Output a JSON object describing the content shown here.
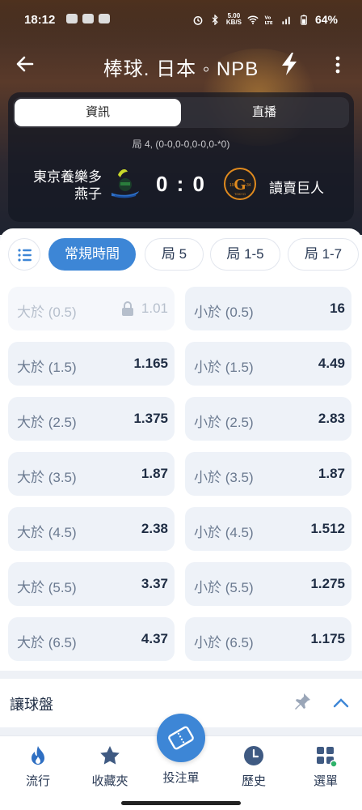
{
  "status": {
    "time": "18:12",
    "speed_top": "5.00",
    "speed_unit": "KB/S",
    "battery": "64%"
  },
  "topbar": {
    "title": "棒球. 日本 ◦ NPB"
  },
  "match": {
    "tabs": [
      {
        "label": "資訊",
        "active": true
      },
      {
        "label": "直播",
        "active": false
      }
    ],
    "inning_info": "局 4, (0-0,0-0,0-0,0-*0)",
    "home_team": "東京養樂多燕子",
    "score": "0 : 0",
    "away_team": "讀賣巨人",
    "away_logo_text": "G",
    "away_logo_years_left": "19",
    "away_logo_years_right": "34",
    "away_logo_city": "TOKYO"
  },
  "filters": [
    {
      "label": "常規時間",
      "active": true
    },
    {
      "label": "局 5",
      "active": false
    },
    {
      "label": "局 1-5",
      "active": false
    },
    {
      "label": "局 1-7",
      "active": false
    }
  ],
  "odds": [
    {
      "over_label": "大於 (0.5)",
      "over_value": "1.01",
      "over_locked": true,
      "under_label": "小於 (0.5)",
      "under_value": "16"
    },
    {
      "over_label": "大於 (1.5)",
      "over_value": "1.165",
      "over_locked": false,
      "under_label": "小於 (1.5)",
      "under_value": "4.49"
    },
    {
      "over_label": "大於 (2.5)",
      "over_value": "1.375",
      "over_locked": false,
      "under_label": "小於 (2.5)",
      "under_value": "2.83"
    },
    {
      "over_label": "大於 (3.5)",
      "over_value": "1.87",
      "over_locked": false,
      "under_label": "小於 (3.5)",
      "under_value": "1.87"
    },
    {
      "over_label": "大於 (4.5)",
      "over_value": "2.38",
      "over_locked": false,
      "under_label": "小於 (4.5)",
      "under_value": "1.512"
    },
    {
      "over_label": "大於 (5.5)",
      "over_value": "3.37",
      "over_locked": false,
      "under_label": "小於 (5.5)",
      "under_value": "1.275"
    },
    {
      "over_label": "大於 (6.5)",
      "over_value": "4.37",
      "over_locked": false,
      "under_label": "小於 (6.5)",
      "under_value": "1.175"
    }
  ],
  "spread_section": {
    "label": "讓球盤"
  },
  "nav": {
    "trending": "流行",
    "favorites": "收藏夾",
    "betslip": "投注單",
    "history": "歷史",
    "menu": "選單"
  },
  "colors": {
    "accent": "#3d86d6",
    "cell_bg": "#eef2f8",
    "value_text": "#1f2d44",
    "label_text": "#6b7a90",
    "flame": "#2f6fc2",
    "menu_dot": "#2fb36a"
  },
  "icons": [
    "back-arrow-icon",
    "bolt-icon",
    "more-vert-icon",
    "list-icon",
    "lock-icon",
    "pin-icon",
    "chevron-up-icon",
    "flame-icon",
    "star-icon",
    "ticket-icon",
    "clock-icon",
    "grid-menu-icon"
  ]
}
